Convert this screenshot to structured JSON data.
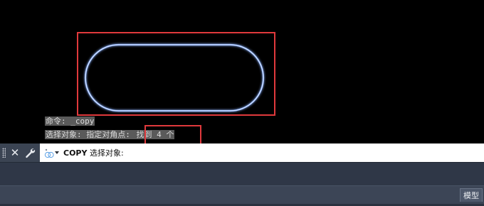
{
  "command_history": {
    "line1": "命令: _copy",
    "line2_prefix": "选择对象: 指定对角点: ",
    "line2_found": "找到 4 个"
  },
  "command_line": {
    "command": "COPY",
    "prompt": " 选择对象:"
  },
  "layout_tabs": {
    "model": "模型"
  },
  "icons": {
    "close": "close-icon",
    "customize": "wrench-icon",
    "recent_commands": "command-prompt-icon"
  },
  "colors": {
    "highlight": "#e0393c",
    "shape_stroke": "#8fb4ff",
    "canvas": "#000000"
  }
}
